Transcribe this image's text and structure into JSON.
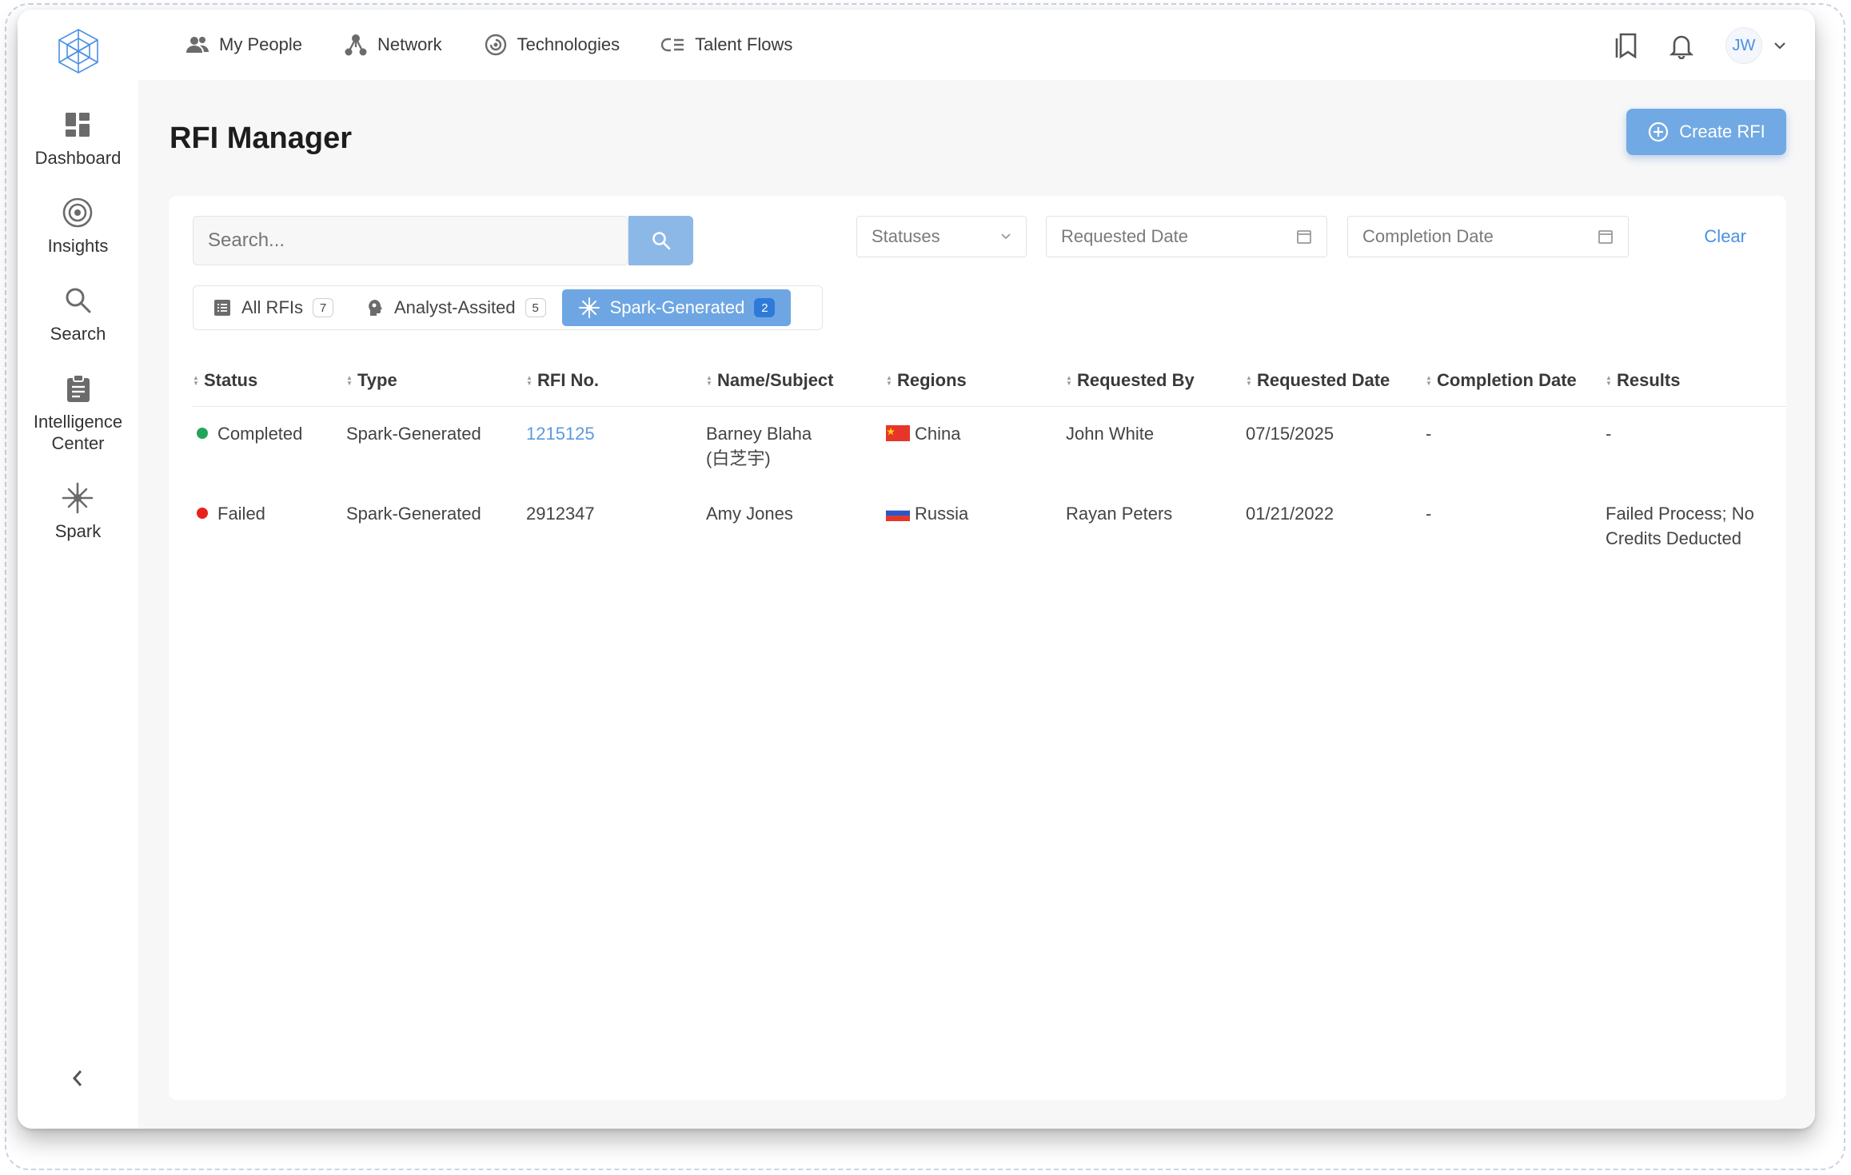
{
  "nav": {
    "items": [
      {
        "label": "My People",
        "icon": "people-icon"
      },
      {
        "label": "Network",
        "icon": "network-icon"
      },
      {
        "label": "Technologies",
        "icon": "technologies-icon"
      },
      {
        "label": "Talent Flows",
        "icon": "talent-flows-icon"
      }
    ],
    "avatar_initials": "JW"
  },
  "sidebar": {
    "items": [
      {
        "label": "Dashboard",
        "icon": "dashboard-icon"
      },
      {
        "label": "Insights",
        "icon": "target-icon"
      },
      {
        "label": "Search",
        "icon": "search-icon"
      },
      {
        "label": "Intelligence Center",
        "icon": "clipboard-icon"
      },
      {
        "label": "Spark",
        "icon": "spark-icon"
      }
    ]
  },
  "page": {
    "title": "RFI Manager",
    "create_label": "Create RFI"
  },
  "filters": {
    "search_placeholder": "Search...",
    "statuses": "Statuses",
    "requested_date": "Requested Date",
    "completion_date": "Completion Date",
    "clear": "Clear"
  },
  "tabs": [
    {
      "label": "All RFIs",
      "count": "7",
      "active": false
    },
    {
      "label": "Analyst-Assited",
      "count": "5",
      "active": false
    },
    {
      "label": "Spark-Generated",
      "count": "2",
      "active": true
    }
  ],
  "table": {
    "columns": [
      "Status",
      "Type",
      "RFI No.",
      "Name/Subject",
      "Regions",
      "Requested By",
      "Requested Date",
      "Completion Date",
      "Results"
    ],
    "rows": [
      {
        "status": "Completed",
        "status_color": "#22a55b",
        "type": "Spark-Generated",
        "rfi_no": "1215125",
        "name_line1": "Barney Blaha",
        "name_line2": "(白芝宇)",
        "region": "China",
        "requested_by": "John White",
        "requested_date": "07/15/2025",
        "completion_date": "-",
        "results_line1": "-",
        "results_line2": ""
      },
      {
        "status": "Failed",
        "status_color": "#e8221d",
        "type": "Spark-Generated",
        "rfi_no": "2912347",
        "name_line1": "Amy Jones",
        "name_line2": "",
        "region": "Russia",
        "requested_by": "Rayan Peters",
        "requested_date": "01/21/2022",
        "completion_date": "-",
        "results_line1": "Failed Process; No",
        "results_line2": "Credits Deducted"
      }
    ]
  },
  "colors": {
    "accent": "#71a9e4",
    "link": "#5b9ae0",
    "completed": "#22a55b",
    "failed": "#e8221d"
  }
}
